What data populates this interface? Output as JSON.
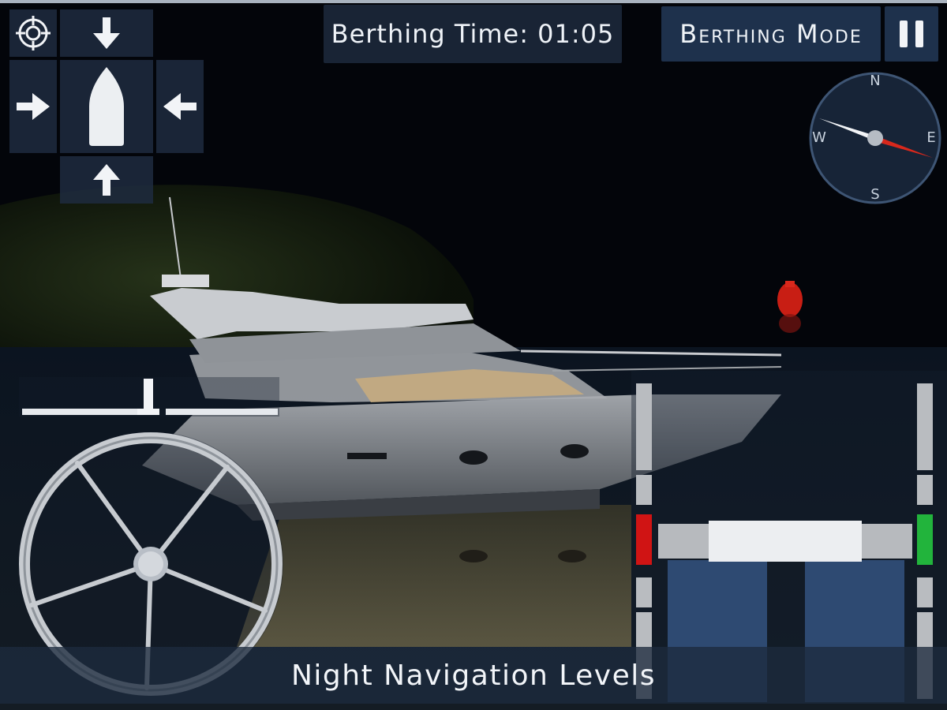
{
  "hud": {
    "timer_text": "Berthing Time: 01:05",
    "mode_text": "Berthing Mode",
    "banner_text": "Night Navigation Levels"
  },
  "compass": {
    "north": "N",
    "east": "E",
    "south": "S",
    "west": "W"
  },
  "controls": {
    "camera_icon": "crosshair-icon",
    "thruster_up_icon": "arrow-down-icon",
    "thruster_down_icon": "arrow-up-icon",
    "thruster_left_icon": "arrow-right-icon",
    "thruster_right_icon": "arrow-left-icon",
    "boat_icon": "boat-hull-icon",
    "pause_icon": "pause-icon"
  },
  "throttle": {
    "left_indicator_color": "#d01414",
    "right_indicator_color": "#22b43c"
  },
  "colors": {
    "panel": "#1e2c40",
    "accent_red": "#d01414",
    "accent_green": "#22b43c",
    "buoy": "#c81e14"
  }
}
